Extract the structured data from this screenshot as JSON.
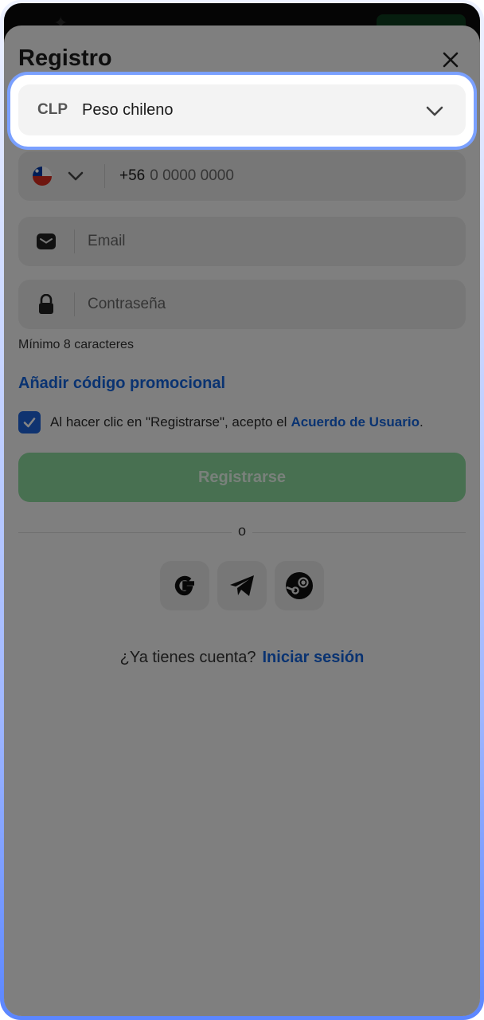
{
  "header": {
    "title": "Registro"
  },
  "currency": {
    "code": "CLP",
    "name": "Peso chileno"
  },
  "phone": {
    "prefix": "+56",
    "placeholder": "0 0000 0000"
  },
  "email": {
    "placeholder": "Email"
  },
  "password": {
    "placeholder": "Contraseña",
    "hint": "Mínimo 8 caracteres"
  },
  "promo_link": "Añadir código promocional",
  "terms": {
    "text": "Al hacer clic en \"Registrarse\", acepto el",
    "link": "Acuerdo de Usuario",
    "suffix": "."
  },
  "register_button": "Registrarse",
  "divider_text": "o",
  "social": [
    "google-icon",
    "telegram-icon",
    "steam-icon"
  ],
  "login": {
    "question": "¿Ya tienes cuenta?",
    "link": "Iniciar sesión"
  },
  "colors": {
    "accent": "#1463d8",
    "register": "#8bd79b",
    "highlight": "#7aa0ff"
  }
}
